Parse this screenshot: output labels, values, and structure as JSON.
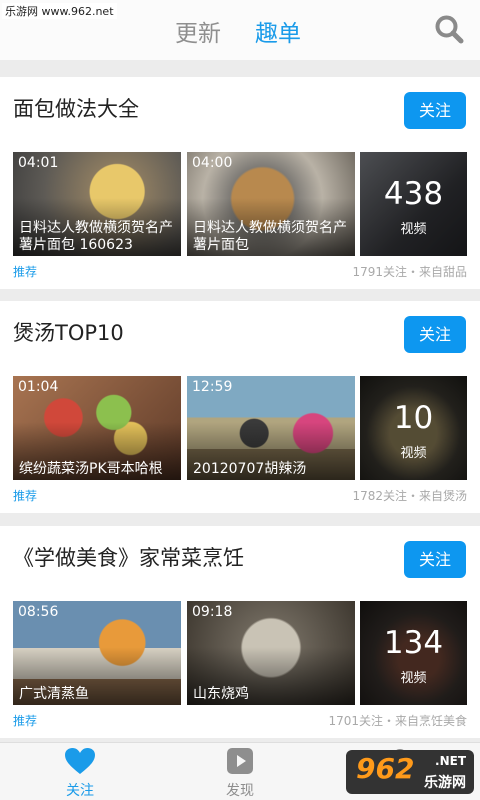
{
  "watermark_top": "乐游网 www.962.net",
  "header": {
    "tab_update": "更新",
    "tab_qudan": "趣单"
  },
  "cards": [
    {
      "title": "面包做法大全",
      "follow": "关注",
      "tag": "推荐",
      "meta": "1791关注・来自甜品",
      "videos": [
        {
          "duration": "04:01",
          "caption": "日料达人教做横须贺名产薯片面包 160623",
          "color": "#7a6a52"
        },
        {
          "duration": "04:00",
          "caption": "日料达人教做横须贺名产薯片面包",
          "color": "#6e6149"
        }
      ],
      "more": {
        "count": "438",
        "label": "视频",
        "color": "#4b4d52"
      }
    },
    {
      "title": "煲汤TOP10",
      "follow": "关注",
      "tag": "推荐",
      "meta": "1782关注・来自煲汤",
      "videos": [
        {
          "duration": "01:04",
          "caption": "缤纷蔬菜汤PK哥本哈根",
          "color": "#8e5a3a"
        },
        {
          "duration": "12:59",
          "caption": "20120707胡辣汤",
          "color": "#6f7f5a"
        }
      ],
      "more": {
        "count": "10",
        "label": "视频",
        "color": "#3b3a33"
      }
    },
    {
      "title": "《学做美食》家常菜烹饪",
      "follow": "关注",
      "tag": "推荐",
      "meta": "1701关注・来自烹饪美食",
      "videos": [
        {
          "duration": "08:56",
          "caption": "广式清蒸鱼",
          "color": "#9a7a5e"
        },
        {
          "duration": "09:18",
          "caption": "山东烧鸡",
          "color": "#5d5548"
        }
      ],
      "more": {
        "count": "134",
        "label": "视频",
        "color": "#4a3f3a"
      }
    }
  ],
  "bottom_nav": {
    "follow": "关注",
    "discover": "发现"
  },
  "logo": {
    "num": "962",
    "net": ".NET",
    "cn": "乐游网"
  },
  "colors": {
    "accent": "#1a9be9",
    "button": "#0d97f0"
  }
}
